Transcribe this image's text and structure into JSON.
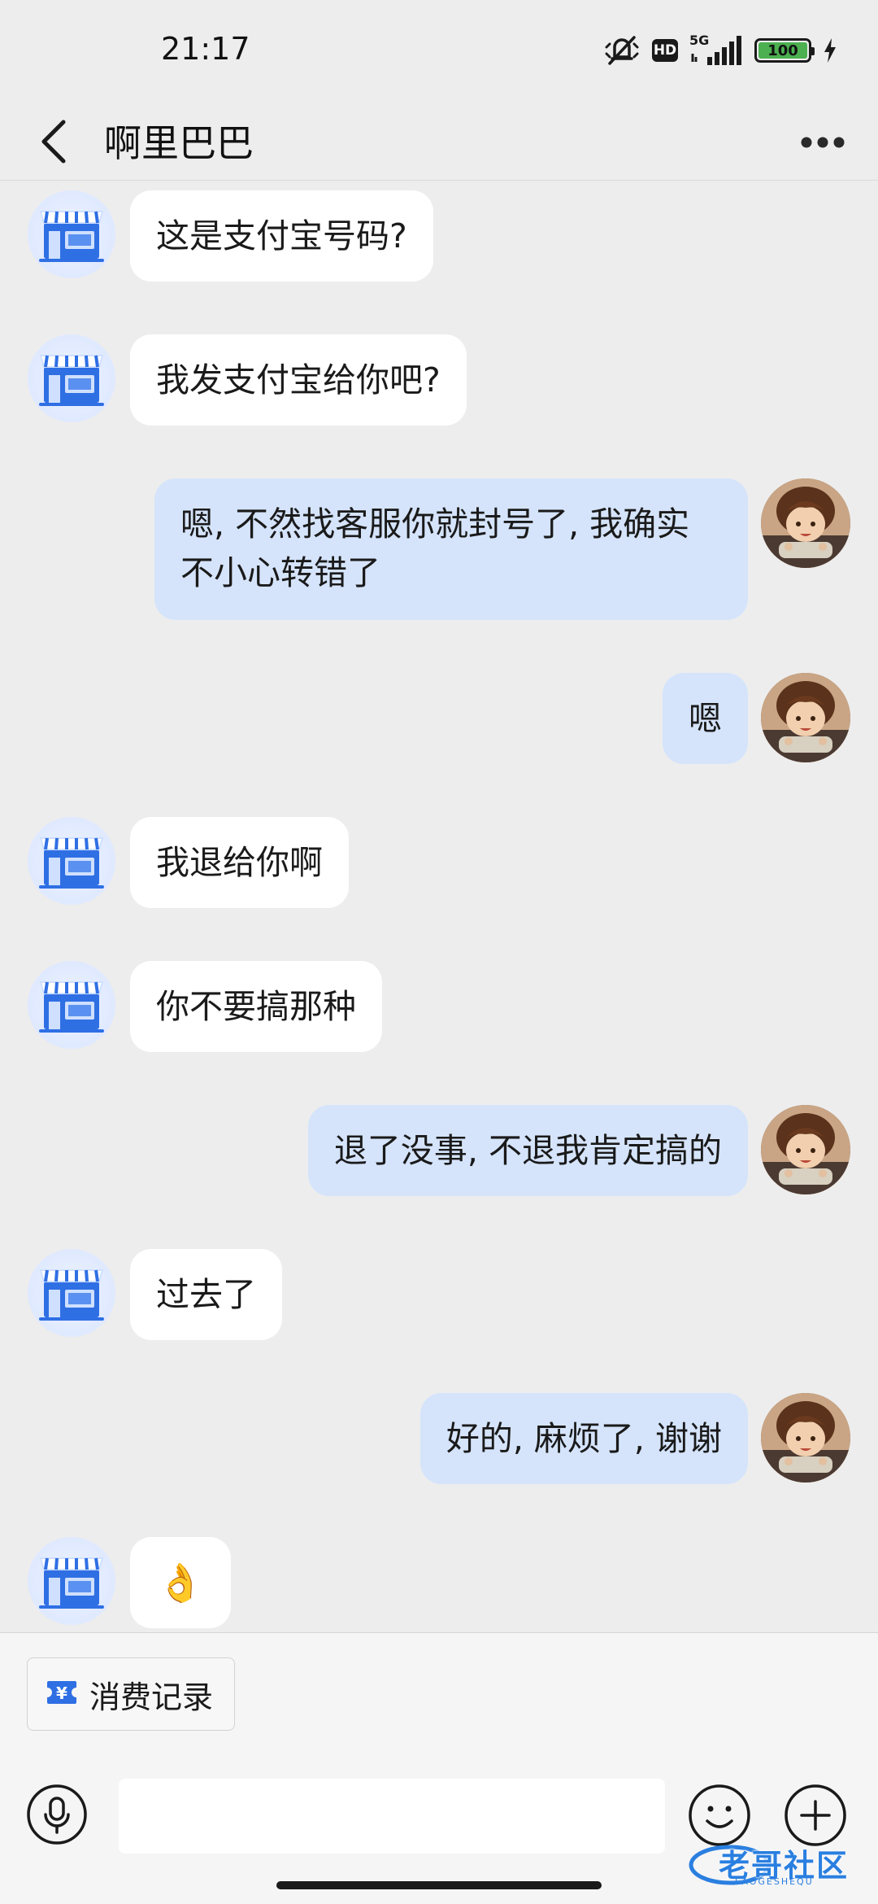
{
  "status_bar": {
    "time": "21:17",
    "network": "5G",
    "hd": "HD",
    "battery": "100"
  },
  "header": {
    "title": "啊里巴巴"
  },
  "messages": [
    {
      "side": "left",
      "text": "这是支付宝号码?"
    },
    {
      "side": "left",
      "text": "我发支付宝给你吧?"
    },
    {
      "side": "right",
      "text": "嗯, 不然找客服你就封号了, 我确实不小心转错了"
    },
    {
      "side": "right",
      "text": "嗯"
    },
    {
      "side": "left",
      "text": "我退给你啊"
    },
    {
      "side": "left",
      "text": "你不要搞那种"
    },
    {
      "side": "right",
      "text": "退了没事, 不退我肯定搞的"
    },
    {
      "side": "left",
      "text": "过去了"
    },
    {
      "side": "right",
      "text": "好的, 麻烦了, 谢谢"
    },
    {
      "side": "left",
      "text": "👌"
    }
  ],
  "quick_actions": {
    "consumption_record": "消费记录"
  },
  "input": {
    "placeholder": ""
  },
  "watermark": {
    "text": "老哥社区",
    "sub": "LAOGESHEQU"
  }
}
